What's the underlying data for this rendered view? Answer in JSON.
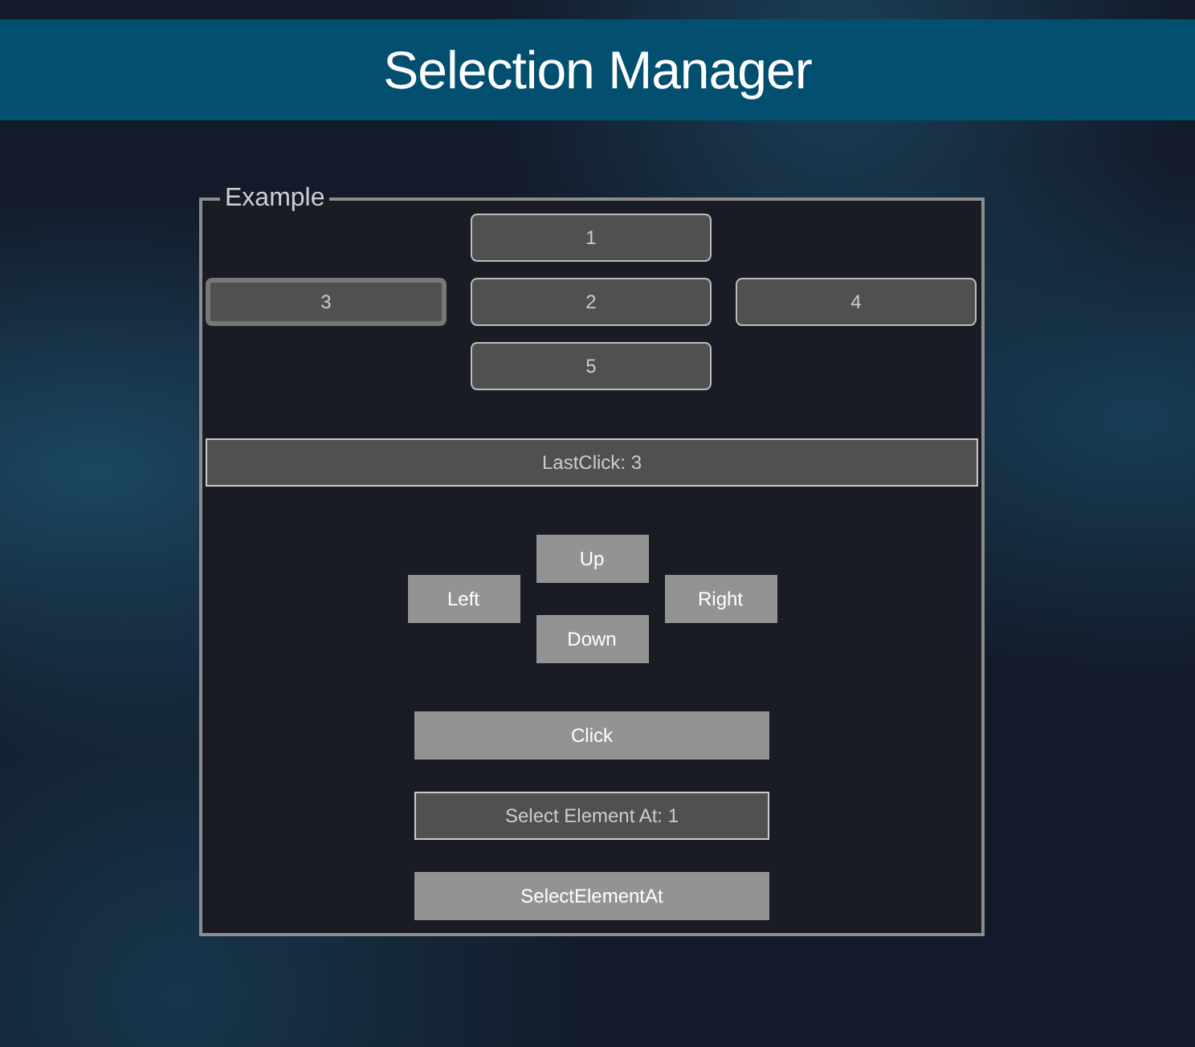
{
  "header": {
    "title": "Selection Manager"
  },
  "example": {
    "legend": "Example",
    "elements": [
      {
        "label": "1",
        "selected": false
      },
      {
        "label": "3",
        "selected": true
      },
      {
        "label": "2",
        "selected": false
      },
      {
        "label": "4",
        "selected": false
      },
      {
        "label": "5",
        "selected": false
      }
    ],
    "last_click": "LastClick: 3",
    "direction_buttons": [
      "Up",
      "Left",
      "Right",
      "Down"
    ],
    "click_button": "Click",
    "select_index_field": {
      "value": "Select Element At: 1"
    },
    "select_button": "SelectElementAt"
  }
}
